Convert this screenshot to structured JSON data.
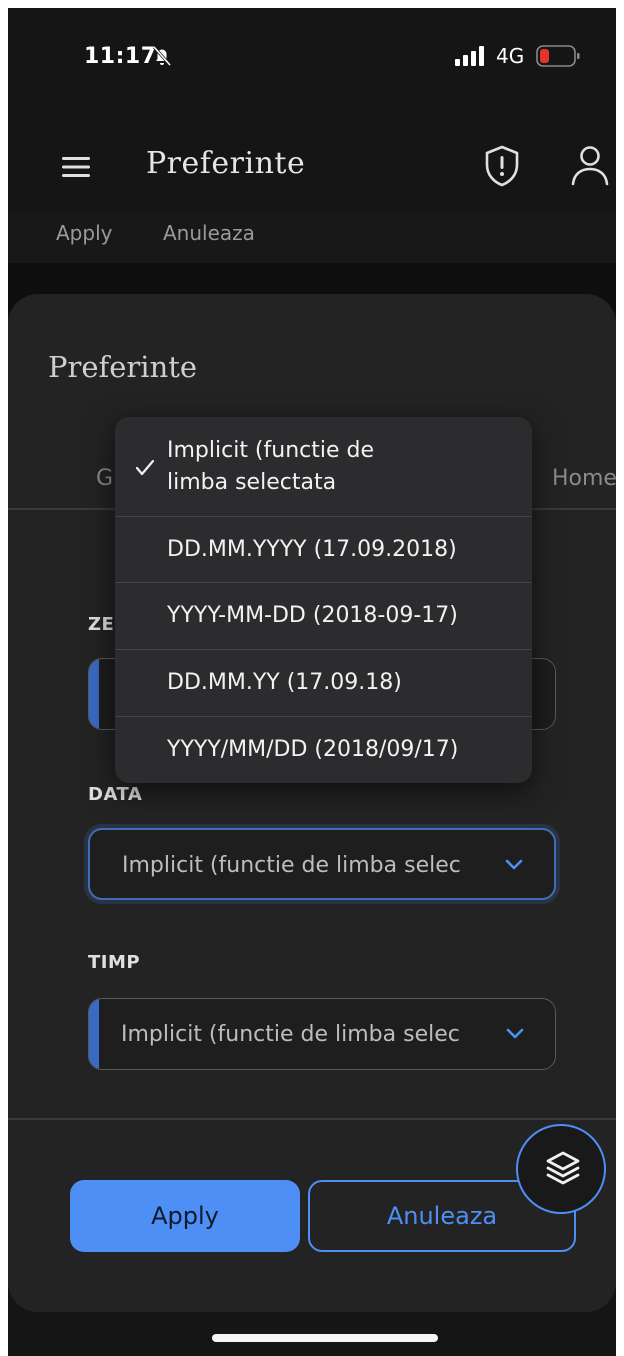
{
  "status_bar": {
    "time": "11:17",
    "network": "4G"
  },
  "header": {
    "title": "Preferinte"
  },
  "peek": {
    "apply_label": "Apply",
    "cancel_label": "Anuleaza"
  },
  "sheet": {
    "title": "Preferinte",
    "tab_left": "G",
    "tab_right": "Home",
    "fields": {
      "zone_label": "ZE",
      "date_label": "DATA",
      "date_value": "Implicit (functie de limba selec",
      "time_label": "TIMP",
      "time_value": "Implicit (functie de limba selec"
    },
    "apply_label": "Apply",
    "cancel_label": "Anuleaza"
  },
  "dropdown": {
    "options": [
      {
        "line1": "Implicit (functie de",
        "line2": "limba selectata",
        "selected": true
      },
      {
        "label": "DD.MM.YYYY (17.09.2018)"
      },
      {
        "label": "YYYY-MM-DD (2018-09-17)"
      },
      {
        "label": "DD.MM.YY (17.09.18)"
      },
      {
        "label": "YYYY/MM/DD (2018/09/17)"
      }
    ]
  },
  "icons": {
    "bell": "bell-slash-icon",
    "signal": "signal-bars-icon",
    "battery": "battery-low-icon",
    "menu": "hamburger-menu-icon",
    "shield": "shield-alert-icon",
    "user": "user-icon",
    "layers": "layers-icon",
    "chevron": "chevron-down-icon",
    "check": "checkmark-icon"
  },
  "colors": {
    "accent": "#4d8ff5",
    "battery_low": "#e5352b",
    "background": "#151515",
    "sheet": "#232323"
  }
}
